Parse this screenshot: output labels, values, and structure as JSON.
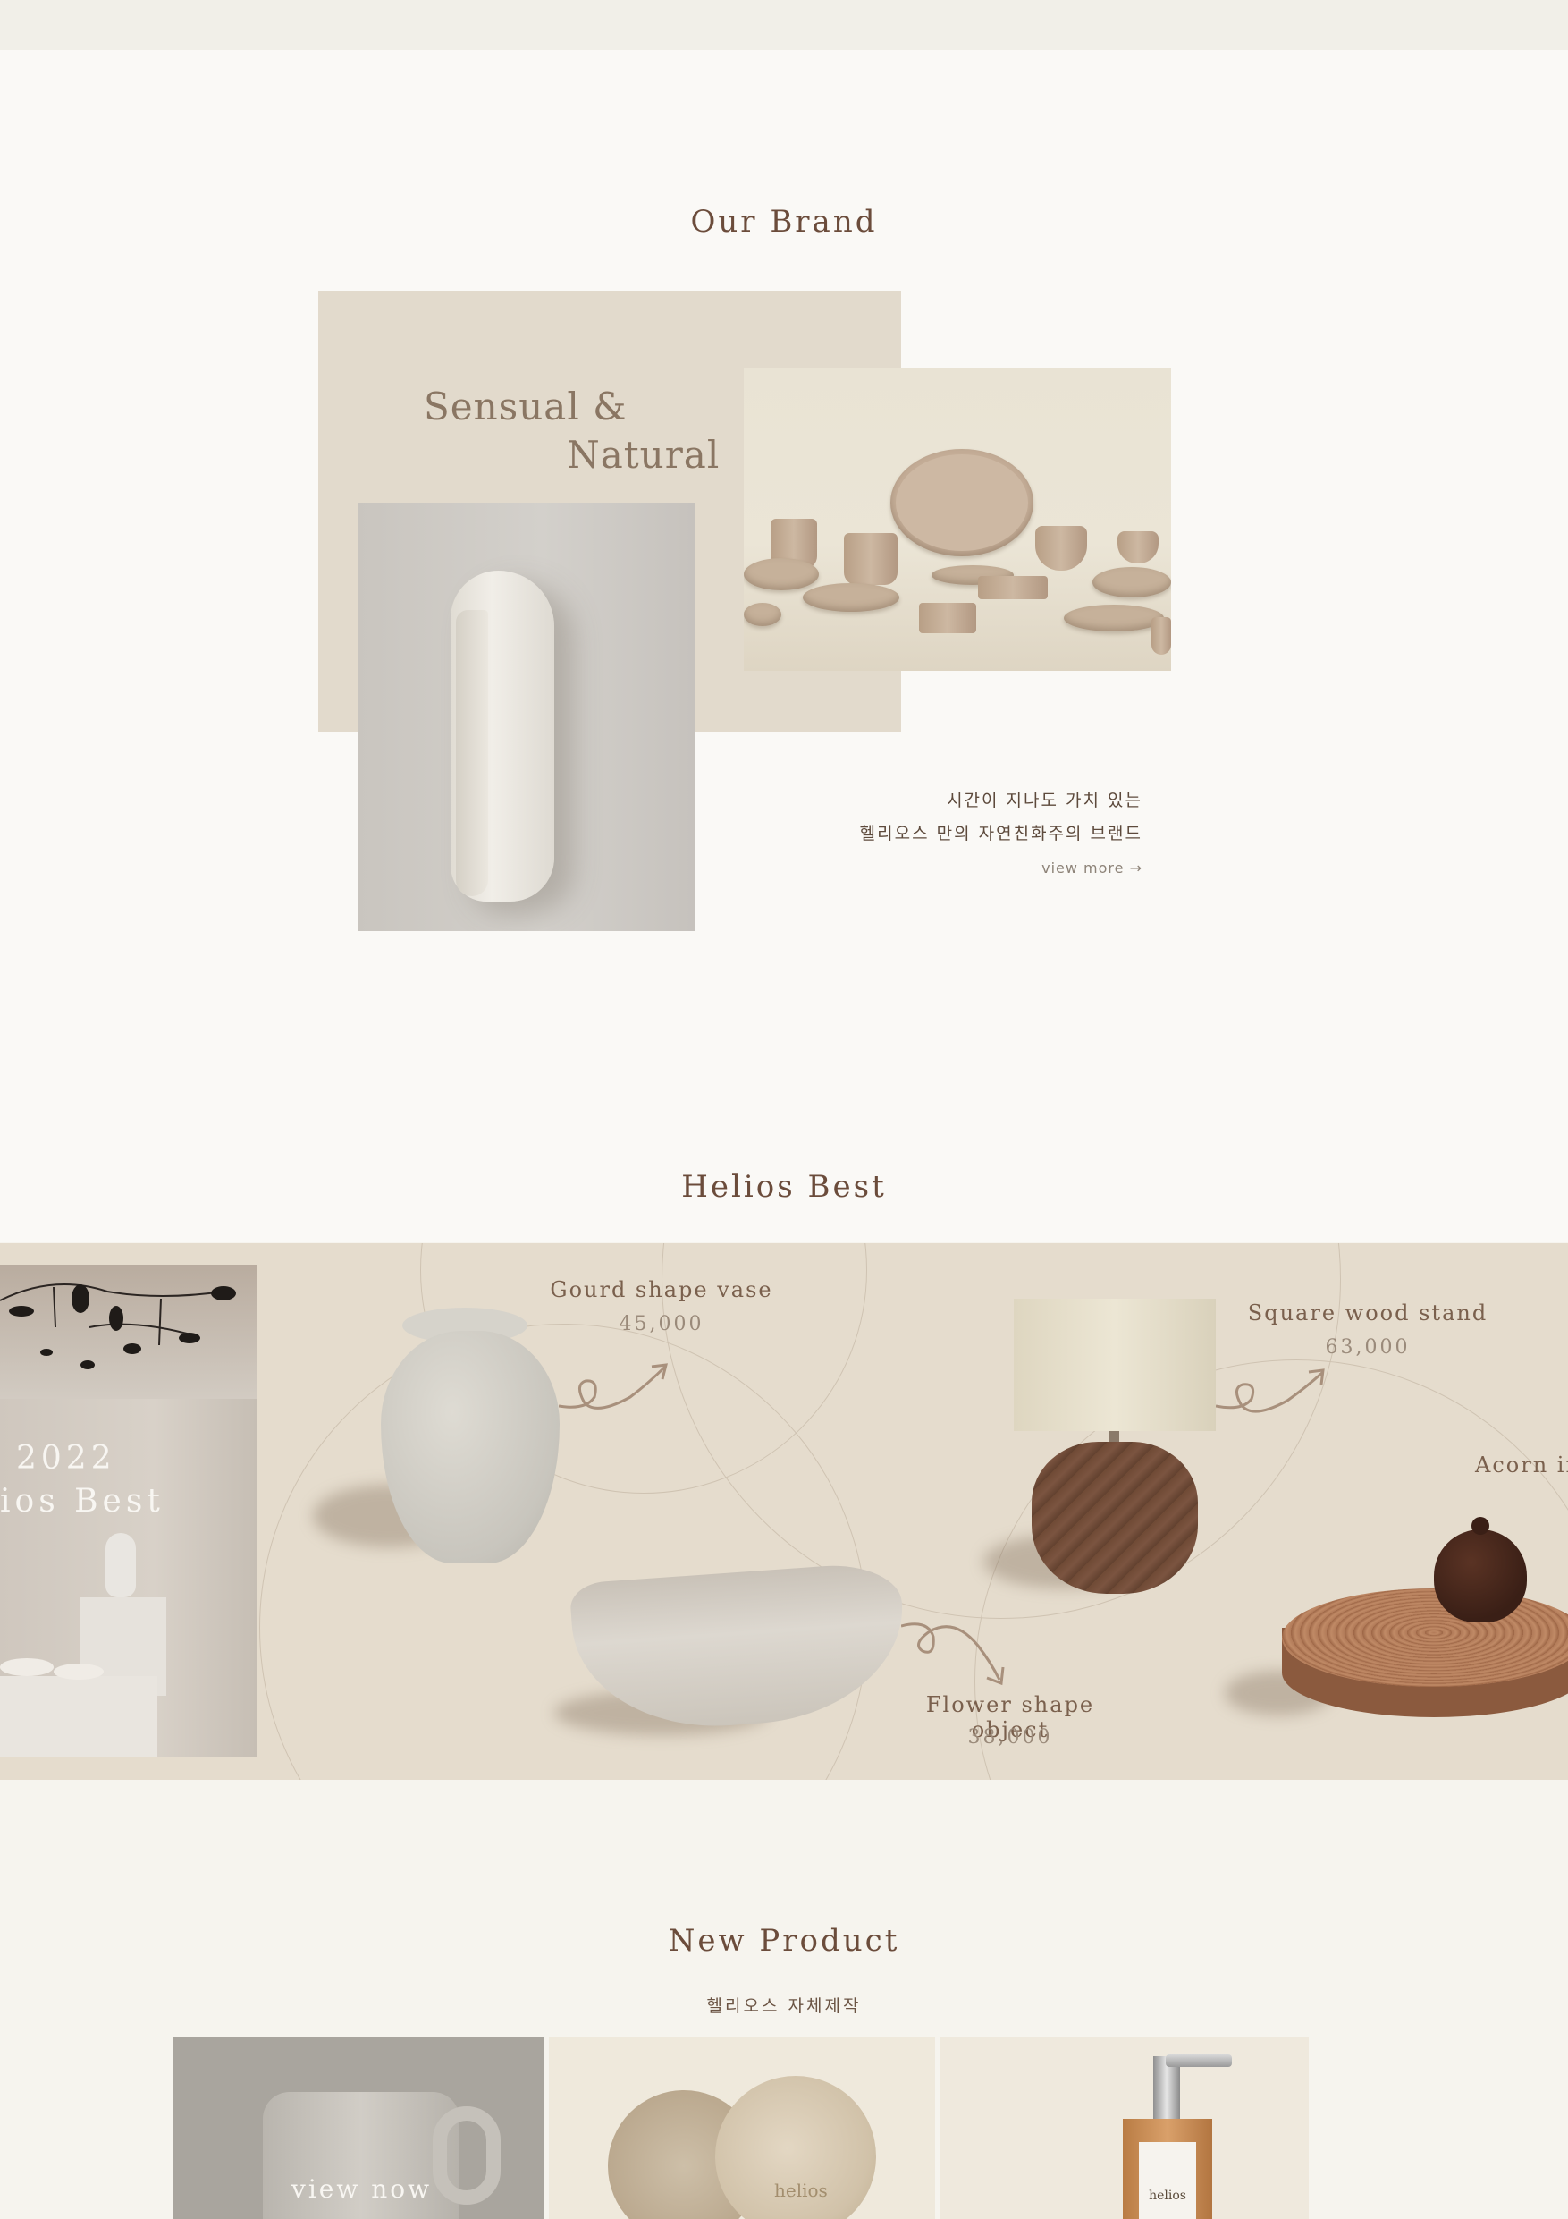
{
  "our_brand": {
    "title": "Our Brand",
    "slogan_line1": "Sensual &",
    "slogan_line2": "Natural",
    "desc_line1": "시간이 지나도 가치 있는",
    "desc_line2": "헬리오스 만의 자연친화주의 브랜드",
    "view_more": "view more →"
  },
  "helios_best": {
    "title": "Helios Best",
    "panel_year": "2022",
    "panel_label": "ios Best",
    "products": [
      {
        "name": "Gourd shape vase",
        "price": "45,000"
      },
      {
        "name": "Square wood stand",
        "price": "63,000"
      },
      {
        "name": "Flower shape object",
        "price": "38,000"
      },
      {
        "name": "Acorn in"
      }
    ]
  },
  "new_product": {
    "title": "New Product",
    "subtitle": "헬리오스 자체제작",
    "view_now": "view now",
    "brand_mark": "helios"
  },
  "colors": {
    "accent": "#6b4c3b",
    "band": "#e5dccd",
    "panel": "#e2dacc",
    "page": "#faf9f6"
  }
}
